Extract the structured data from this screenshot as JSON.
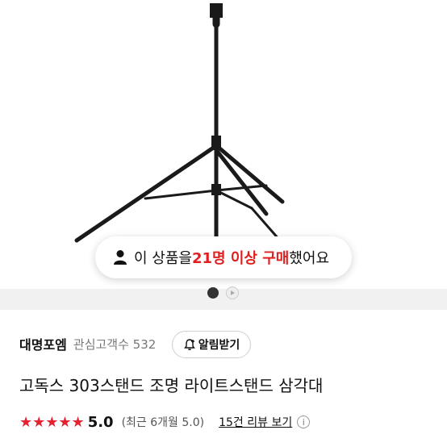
{
  "toast": {
    "prefix": "이 상품을 ",
    "highlight": "21명 이상 구매",
    "suffix": " 했어요"
  },
  "gallery": {
    "pages": 2,
    "active_index": 0,
    "second_is_video": true
  },
  "seller": {
    "name": "대명포엠",
    "fans": "관심고객수 532",
    "alarm_button": "알림받기"
  },
  "product": {
    "title": "고독스 303스탠드 조명 라이트스탠드 삼각대"
  },
  "rating": {
    "stars": "★★★★★",
    "score": "5.0",
    "recent": "(최근 6개월 5.0)",
    "review_link": "15건 리뷰 보기",
    "info": "i"
  },
  "colors": {
    "accent": "#e52231",
    "toast_highlight": "#e02020"
  }
}
